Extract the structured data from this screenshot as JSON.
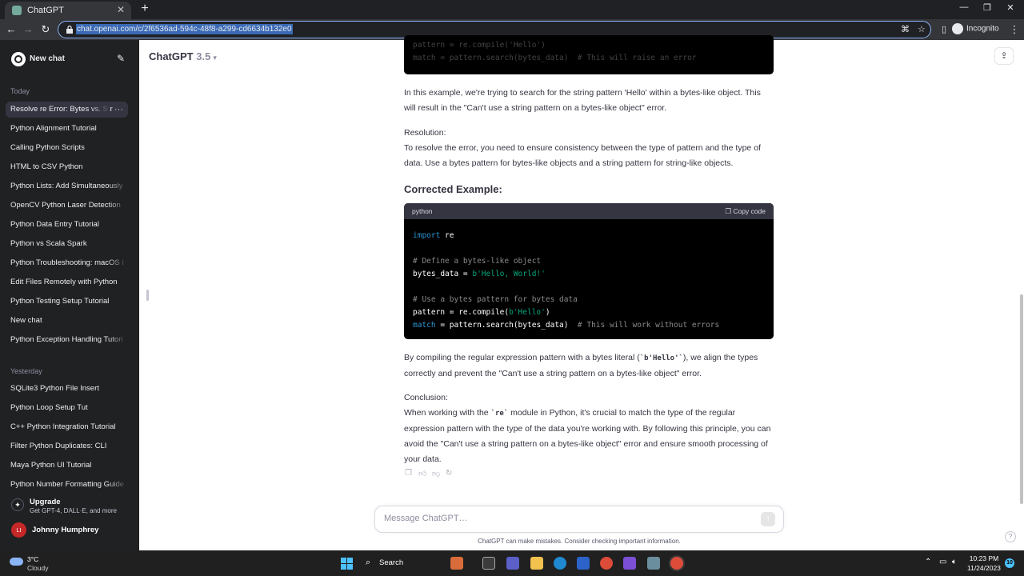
{
  "browser": {
    "tab_title": "ChatGPT",
    "url": "chat.openai.com/c/2f6536ad-594c-48f8-a299-cd6634b132e0",
    "profile_label": "Incognito"
  },
  "sidebar": {
    "new_chat_label": "New chat",
    "sections": [
      {
        "label": "Today",
        "items": [
          {
            "label": "Resolve re Error: Bytes vs. Str",
            "active": true
          },
          {
            "label": "Python Alignment Tutorial"
          },
          {
            "label": "Calling Python Scripts"
          },
          {
            "label": "HTML to CSV Python"
          },
          {
            "label": "Python Lists: Add Simultaneously"
          },
          {
            "label": "OpenCV Python Laser Detection"
          },
          {
            "label": "Python Data Entry Tutorial"
          },
          {
            "label": "Python vs Scala Spark"
          },
          {
            "label": "Python Troubleshooting: macOS I"
          },
          {
            "label": "Edit Files Remotely with Python"
          },
          {
            "label": "Python Testing Setup Tutorial"
          },
          {
            "label": "New chat"
          },
          {
            "label": "Python Exception Handling Tutori"
          }
        ]
      },
      {
        "label": "Yesterday",
        "items": [
          {
            "label": "SQLite3 Python File Insert"
          },
          {
            "label": "Python Loop Setup Tut"
          },
          {
            "label": "C++ Python Integration Tutorial"
          },
          {
            "label": "Filter Python Duplicates: CLI"
          },
          {
            "label": "Maya Python UI Tutorial"
          },
          {
            "label": "Python Number Formatting Guide"
          }
        ]
      }
    ],
    "upgrade": {
      "title": "Upgrade",
      "subtitle": "Get GPT-4, DALL·E, and more"
    },
    "user": {
      "initials": "LI",
      "name": "Johnny Humphrey"
    }
  },
  "header": {
    "model_name": "ChatGPT",
    "model_version": "3.5"
  },
  "content": {
    "top_code_tail": [
      "pattern = re.compile('Hello')",
      "match = pattern.search(bytes_data)  # This will raise an error"
    ],
    "para_example": "In this example, we're trying to search for the string pattern 'Hello' within a bytes-like object. This will result in the \"Can't use a string pattern on a bytes-like object\" error.",
    "resolution_label": "Resolution:",
    "resolution_text": "To resolve the error, you need to ensure consistency between the type of pattern and the type of data. Use a bytes pattern for bytes-like objects and a string pattern for string-like objects.",
    "corrected_heading": "Corrected Example:",
    "code": {
      "language": "python",
      "copy_label": "Copy code"
    },
    "para_compile_a": "By compiling the regular expression pattern with a bytes literal (",
    "para_compile_code": "`b'Hello'`",
    "para_compile_b": "), we align the types correctly and prevent the \"Can't use a string pattern on a bytes-like object\" error.",
    "conclusion_label": "Conclusion:",
    "conclusion_a": "When working with the ",
    "conclusion_code": "`re`",
    "conclusion_b": " module in Python, it's crucial to match the type of the regular expression pattern with the type of the data you're working with. By following this principle, you can avoid the \"Can't use a string pattern on a bytes-like object\" error and ensure smooth processing of your data."
  },
  "composer": {
    "placeholder": "Message ChatGPT…",
    "disclaimer": "ChatGPT can make mistakes. Consider checking important information."
  },
  "taskbar": {
    "weather_temp": "3°C",
    "weather_desc": "Cloudy",
    "search_label": "Search",
    "time": "10:23 PM",
    "date": "11/24/2023",
    "notification_count": "10"
  },
  "colors": {
    "sidebar_bg": "#202123",
    "code_bg": "#000000",
    "code_keyword": "#2e95d3",
    "code_string": "#00a67d",
    "code_comment": "#8a8a8a"
  }
}
